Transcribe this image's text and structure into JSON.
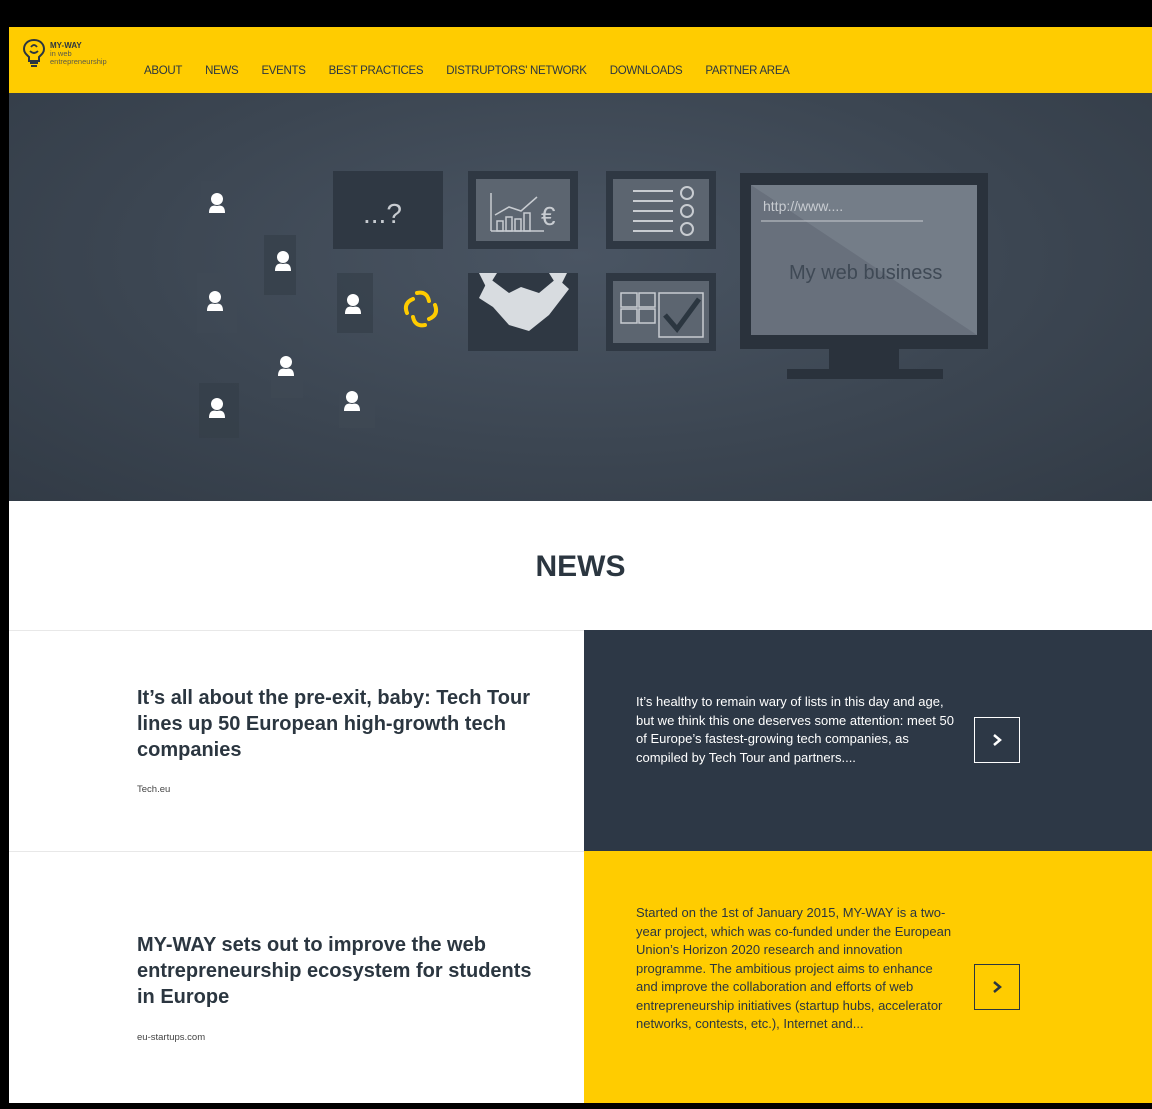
{
  "logo": {
    "title": "MY-WAY",
    "subtitle": "in web entrepreneurship"
  },
  "nav": [
    "ABOUT",
    "NEWS",
    "EVENTS",
    "BEST PRACTICES",
    "DISTRUPTORS' NETWORK",
    "DOWNLOADS",
    "PARTNER AREA"
  ],
  "hero": {
    "question_mark": "...?",
    "url_text": "http://www....",
    "screen_text": "My web business"
  },
  "news": {
    "heading": "NEWS",
    "articles": [
      {
        "title": "It’s all about the pre-exit, baby: Tech Tour lines up 50 European high-growth tech companies",
        "source": "Tech.eu",
        "summary": "It’s healthy to remain wary of lists in this day and age, but we think this one deserves some attention: meet 50 of Europe’s fastest-growing tech companies, as compiled by Tech Tour and partners...."
      },
      {
        "title": "MY-WAY sets out to improve the web entrepreneurship ecosystem for students in Europe",
        "source": "eu-startups.com",
        "summary": "Started on the 1st of January 2015, MY-WAY is a two-year project, which was co-funded under the European Union’s Horizon 2020 research and innovation programme. The ambitious project aims to enhance and improve the collaboration and efforts of web entrepreneurship initiatives (startup hubs, accelerator networks, contests, etc.), Internet and..."
      }
    ]
  },
  "colors": {
    "accent": "#ffcc00",
    "dark": "#2d3846",
    "hero_bg": "#3c4652"
  }
}
